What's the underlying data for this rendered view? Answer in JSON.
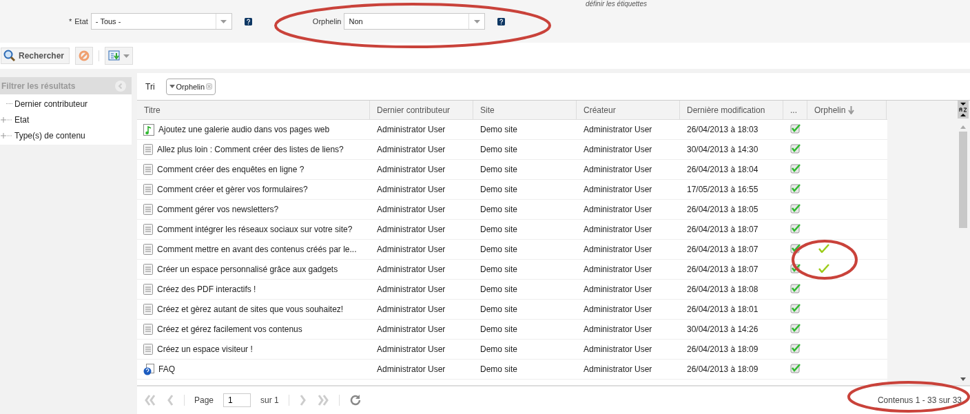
{
  "top_link": "définir les étiquettes",
  "filters": [
    {
      "marker": "*",
      "label": "Etat",
      "value": "- Tous -"
    },
    {
      "label": "Orphelin",
      "value": "Non"
    }
  ],
  "toolbar": {
    "search_button": "Rechercher"
  },
  "sidebar": {
    "title": "Filtrer les résultats",
    "items": [
      {
        "label": "Dernier contributeur",
        "expandable": false
      },
      {
        "label": "Etat",
        "expandable": true
      },
      {
        "label": "Type(s) de contenu",
        "expandable": true
      }
    ]
  },
  "sort": {
    "label": "Tri",
    "chips": [
      "Orphelin"
    ]
  },
  "table": {
    "columns": [
      "Titre",
      "Dernier contributeur",
      "Site",
      "Créateur",
      "Dernière modification",
      "...",
      "Orphelin"
    ],
    "rows": [
      {
        "kind": "audio",
        "title": "Ajoutez une galerie audio dans vos pages web",
        "contributor": "Administrator User",
        "site": "Demo site",
        "creator": "Administrator User",
        "modified": "26/04/2013 à 18:03",
        "orphan": false
      },
      {
        "kind": "page",
        "title": "Allez plus loin : Comment créer des listes de liens?",
        "contributor": "Administrator User",
        "site": "Demo site",
        "creator": "Administrator User",
        "modified": "30/04/2013 à 14:30",
        "orphan": false
      },
      {
        "kind": "page",
        "title": "Comment créer des enquêtes en ligne ?",
        "contributor": "Administrator User",
        "site": "Demo site",
        "creator": "Administrator User",
        "modified": "26/04/2013 à 18:04",
        "orphan": false
      },
      {
        "kind": "page",
        "title": "Comment créer et gèrer vos formulaires?",
        "contributor": "Administrator User",
        "site": "Demo site",
        "creator": "Administrator User",
        "modified": "17/05/2013 à 16:55",
        "orphan": false
      },
      {
        "kind": "page",
        "title": "Comment gérer vos newsletters?",
        "contributor": "Administrator User",
        "site": "Demo site",
        "creator": "Administrator User",
        "modified": "26/04/2013 à 18:05",
        "orphan": false
      },
      {
        "kind": "page",
        "title": "Comment intégrer les réseaux sociaux sur votre site?",
        "contributor": "Administrator User",
        "site": "Demo site",
        "creator": "Administrator User",
        "modified": "26/04/2013 à 18:07",
        "orphan": false
      },
      {
        "kind": "page",
        "title": "Comment mettre en avant des contenus créés par le...",
        "contributor": "Administrator User",
        "site": "Demo site",
        "creator": "Administrator User",
        "modified": "26/04/2013 à 18:07",
        "orphan": true
      },
      {
        "kind": "page",
        "title": "Créer un espace personnalisé grâce aux gadgets",
        "contributor": "Administrator User",
        "site": "Demo site",
        "creator": "Administrator User",
        "modified": "26/04/2013 à 18:07",
        "orphan": true
      },
      {
        "kind": "page",
        "title": "Créez des PDF interactifs !",
        "contributor": "Administrator User",
        "site": "Demo site",
        "creator": "Administrator User",
        "modified": "26/04/2013 à 18:08",
        "orphan": false
      },
      {
        "kind": "page",
        "title": "Créez et gèrez autant de sites que vous souhaitez!",
        "contributor": "Administrator User",
        "site": "Demo site",
        "creator": "Administrator User",
        "modified": "26/04/2013 à 18:01",
        "orphan": false
      },
      {
        "kind": "page",
        "title": "Créez et gérez facilement vos contenus",
        "contributor": "Administrator User",
        "site": "Demo site",
        "creator": "Administrator User",
        "modified": "30/04/2013 à 14:26",
        "orphan": false
      },
      {
        "kind": "page",
        "title": "Créez un espace visiteur !",
        "contributor": "Administrator User",
        "site": "Demo site",
        "creator": "Administrator User",
        "modified": "26/04/2013 à 18:09",
        "orphan": false
      },
      {
        "kind": "faq",
        "title": "FAQ",
        "contributor": "Administrator User",
        "site": "Demo site",
        "creator": "Administrator User",
        "modified": "26/04/2013 à 18:09",
        "orphan": false
      }
    ]
  },
  "pager": {
    "page_label": "Page",
    "page": "1",
    "of_label": "sur 1",
    "summary": "Contenus 1 - 33 sur 33"
  }
}
